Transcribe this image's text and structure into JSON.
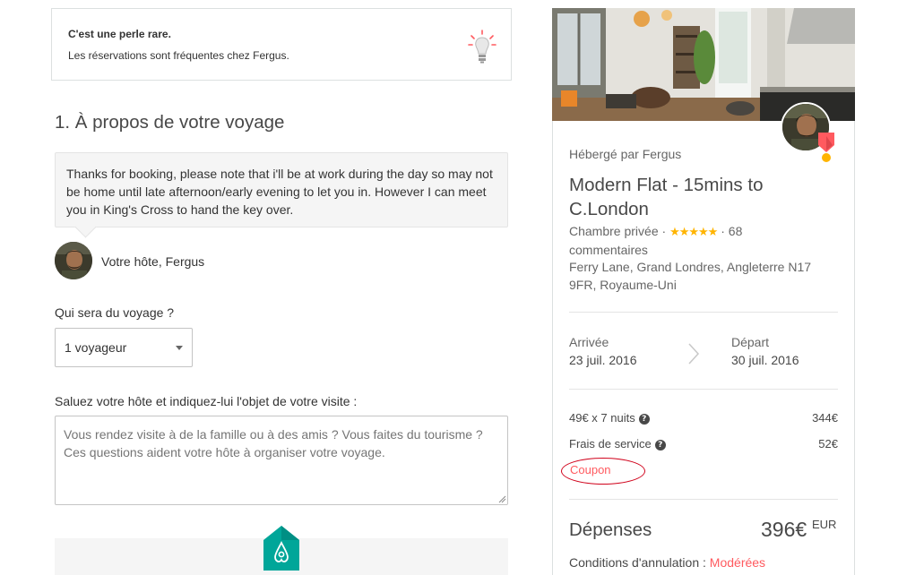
{
  "tip": {
    "title": "C'est une perle rare.",
    "text": "Les réservations sont fréquentes chez Fergus.",
    "icon": "lightbulb-icon"
  },
  "trip": {
    "section_title": "1. À propos de votre voyage",
    "host_message": "Thanks for booking, please note that i'll be at work during the day so may not be home until late afternoon/early evening to let you in. However I can meet you in King's Cross to hand the key over.",
    "host_label": "Votre hôte, Fergus",
    "who_label": "Qui sera du voyage ?",
    "guests_selected": "1 voyageur",
    "hello_label": "Saluez votre hôte et indiquez-lui l'objet de votre visite :",
    "message_placeholder": "Vous rendez visite à de la famille ou à des amis ? Vous faites du tourisme ? Ces questions aident votre hôte à organiser votre voyage."
  },
  "listing": {
    "hosted_by": "Hébergé par Fergus",
    "title": "Modern Flat - 15mins to C.London",
    "room_type": "Chambre privée",
    "stars": "★★★★★",
    "review_count": "68",
    "reviews_word": "commentaires",
    "address": "Ferry Lane, Grand Londres, Angleterre N17 9FR, Royaume-Uni",
    "arrival_label": "Arrivée",
    "arrival_date": "23 juil. 2016",
    "depart_label": "Départ",
    "depart_date": "30 juil. 2016"
  },
  "pricing": {
    "nights_label": "49€ x 7 nuits",
    "nights_value": "344€",
    "service_label": "Frais de service",
    "service_value": "52€",
    "help_glyph": "?",
    "coupon_label": "Coupon",
    "total_label": "Dépenses",
    "total_value": "396€",
    "currency": "EUR",
    "cancel_label": "Conditions d'annulation :",
    "cancel_policy": "Modérées"
  },
  "colors": {
    "accent": "#ff5a5f",
    "star": "#ffb400",
    "brand": "#00a699",
    "annotation": "#d0021b"
  }
}
